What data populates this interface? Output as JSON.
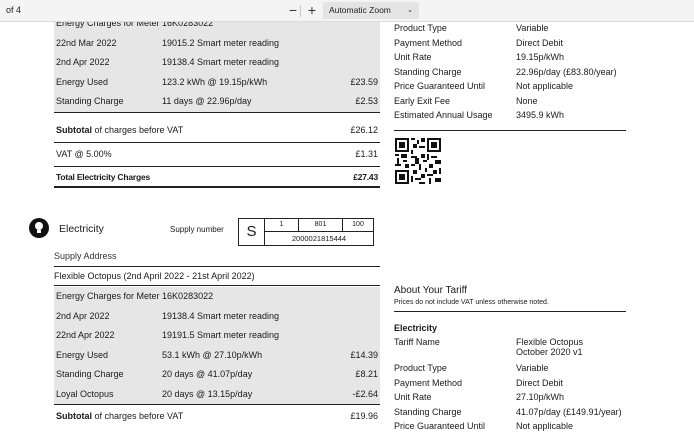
{
  "toolbar": {
    "page_of": "of 4",
    "zoom_out": "−",
    "zoom_in": "+",
    "zoom_label": "Automatic Zoom",
    "zoom_caret": "⌄"
  },
  "top_block": {
    "header": "Energy Charges for Meter 16K0283022",
    "rows": [
      {
        "label": "22nd Mar 2022",
        "detail": "19015.2 Smart meter reading",
        "amount": ""
      },
      {
        "label": "2nd Apr 2022",
        "detail": "19138.4 Smart meter reading",
        "amount": ""
      },
      {
        "label": "Energy Used",
        "detail": "123.2 kWh @ 19.15p/kWh",
        "amount": "£23.59"
      },
      {
        "label": "Standing Charge",
        "detail": "11 days @ 22.96p/day",
        "amount": "£2.53"
      }
    ],
    "subtotal_bold": "Subtotal",
    "subtotal_rest": " of charges before VAT",
    "subtotal_amount": "£26.12",
    "vat_label": "VAT @ 5.00%",
    "vat_amount": "£1.31",
    "total_label": "Total Electricity Charges",
    "total_amount": "£27.43"
  },
  "electricity": {
    "title": "Electricity",
    "supply_number_label": "Supply number",
    "mpan_s": "S",
    "mpan_top": [
      "1",
      "801",
      "100"
    ],
    "mpan_bottom": "2000021815444",
    "supply_address_label": "Supply Address",
    "tariff_period": "Flexible Octopus (2nd April 2022 - 21st April 2022)"
  },
  "bottom_block": {
    "header": "Energy Charges for Meter 16K0283022",
    "rows": [
      {
        "label": "2nd Apr 2022",
        "detail": "19138.4 Smart meter reading",
        "amount": ""
      },
      {
        "label": "22nd Apr 2022",
        "detail": "19191.5 Smart meter reading",
        "amount": ""
      },
      {
        "label": "Energy Used",
        "detail": "53.1 kWh @ 27.10p/kWh",
        "amount": "£14.39"
      },
      {
        "label": "Standing Charge",
        "detail": "20 days @ 41.07p/day",
        "amount": "£8.21"
      },
      {
        "label": "Loyal Octopus",
        "detail": "20 days @ 13.15p/day",
        "amount": "-£2.64"
      }
    ],
    "subtotal_bold": "Subtotal",
    "subtotal_rest": " of charges before VAT",
    "subtotal_amount": "£19.96"
  },
  "right_top": {
    "rows": [
      {
        "k": "Product Type",
        "v": "Variable"
      },
      {
        "k": "Payment Method",
        "v": "Direct Debit"
      },
      {
        "k": "Unit Rate",
        "v": "19.15p/kWh"
      },
      {
        "k": "Standing Charge",
        "v": "22.96p/day (£83.80/year)"
      },
      {
        "k": "Price Guaranteed Until",
        "v": "Not applicable"
      },
      {
        "k": "Early Exit Fee",
        "v": "None"
      },
      {
        "k": "Estimated Annual Usage",
        "v": "3495.9 kWh"
      }
    ]
  },
  "about": {
    "title": "About Your Tariff",
    "note": "Prices do not include VAT unless otherwise noted.",
    "section": "Electricity",
    "tariff_name_label": "Tariff Name",
    "tariff_name_line1": "Flexible Octopus",
    "tariff_name_line2": "October 2020 v1",
    "rows": [
      {
        "k": "Product Type",
        "v": "Variable"
      },
      {
        "k": "Payment Method",
        "v": "Direct Debit"
      },
      {
        "k": "Unit Rate",
        "v": "27.10p/kWh"
      },
      {
        "k": "Standing Charge",
        "v": "41.07p/day (£149.91/year)"
      },
      {
        "k": "Price Guaranteed Until",
        "v": "Not applicable"
      }
    ]
  },
  "colors": {
    "shade": "#e6e6e6",
    "toolbar": "#f4f4f4",
    "text": "#1a1a1a"
  }
}
